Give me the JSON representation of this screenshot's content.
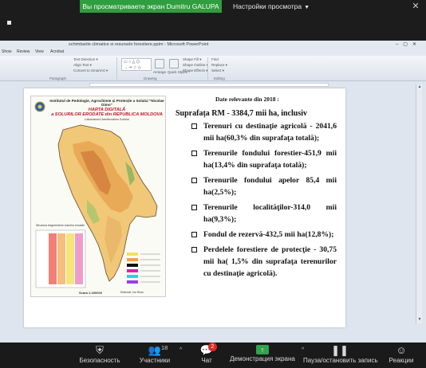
{
  "banner": {
    "sharing_text": "Вы просматриваете экран Dumitru GALUPA",
    "view_options": "Настройки просмотра"
  },
  "ppt": {
    "window_title": "schimbarile climatice si resursele forestiere.pptm  -  Microsoft PowerPoint",
    "tabs": [
      "Show",
      "Review",
      "View",
      "Acrobat"
    ],
    "ribbon": {
      "items": [
        "Text Direction ▾",
        "Align Text ▾",
        "Convert to SmartArt ▾",
        "Arrange",
        "Quick Styles",
        "Shape Fill ▾",
        "Shape Outline ▾",
        "Shape Effects ▾",
        "Find",
        "Replace ▾",
        "Select ▾"
      ],
      "groups": [
        "Paragraph",
        "Drawing",
        "Editing"
      ]
    }
  },
  "slide": {
    "map": {
      "institute": "Institutul de Pedologie, Agrochimie și Protecție a Solului \"Nicolae Dimo\"",
      "title_line1": "HARTA DIGITALĂ",
      "title_line2": "a SOLURILOR ERODATE din REPUBLICA MOLDOVA",
      "subtitle": "Laboratorul Ameliorarea Solului",
      "legend_caption": "Structura fragmentelor solurilor erodate",
      "scale": "Scara 1:200000",
      "credit": "Elaborat: Ion Rusu"
    },
    "heading": "Date relevante din  2018 :",
    "surface": "Suprafața RM - 3384,7 mii ha, inclusiv",
    "bullets": [
      "Terenuri cu destinaţie agricolă - 2041,6 mii ha(60,3% din suprafaţa totală);",
      "Terenurile fondului forestier-451,9 mii ha(13,4% din suprafaţa totală);",
      "Terenurile fondului apelor 85,4 mii ha(2,5%);",
      "Terenurile localităţilor-314,0 mii ha(9,3%);",
      "Fondul de rezervă-432,5 mii ha(12,8%);",
      "Perdelele forestiere de protecţie - 30,75 mii ha( 1,5% din suprafaţa terenurilor cu destinaţie agricolă)."
    ]
  },
  "toolbar": {
    "security": "Безопасность",
    "participants": "Участники",
    "participants_count": "18",
    "chat": "Чат",
    "chat_badge": "2",
    "screen_demo": "Демонстрация экрана",
    "pause": "Пауза/остановить запись",
    "reactions": "Реакции"
  },
  "colors": {
    "share_green": "#2e9e3e",
    "badge_red": "#e02828",
    "map_title_red": "#c0182a"
  }
}
